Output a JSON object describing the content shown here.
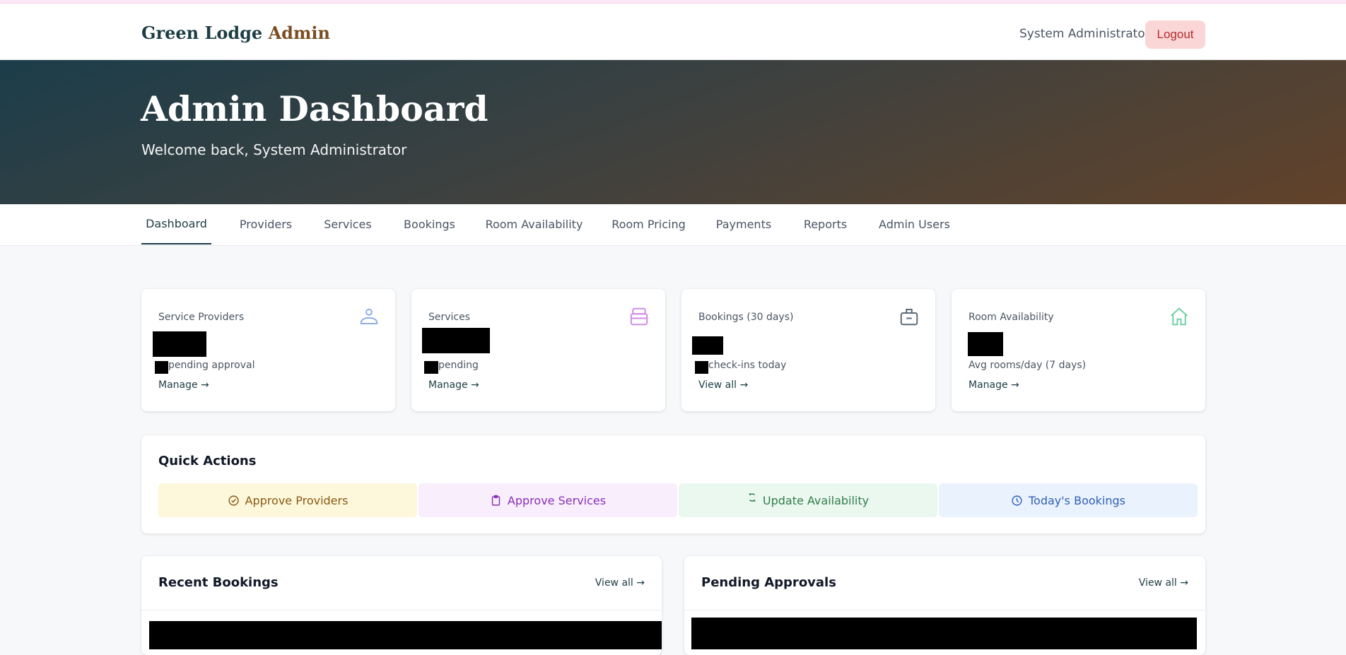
{
  "header": {
    "brand_main": "Green Lodge",
    "brand_accent": "Admin",
    "user_name": "System Administrator",
    "logout_label": "Logout"
  },
  "hero": {
    "title": "Admin Dashboard",
    "subtitle": "Welcome back, System Administrator"
  },
  "tabs": [
    {
      "label": "Dashboard",
      "active": true
    },
    {
      "label": "Providers"
    },
    {
      "label": "Services"
    },
    {
      "label": "Bookings"
    },
    {
      "label": "Room Availability"
    },
    {
      "label": "Room Pricing"
    },
    {
      "label": "Payments"
    },
    {
      "label": "Reports"
    },
    {
      "label": "Admin Users"
    }
  ],
  "stats": [
    {
      "label": "Service Providers",
      "sub": "pending approval",
      "link": "Manage →",
      "icon": "provider-icon",
      "color": "#8fb0e6"
    },
    {
      "label": "Services",
      "sub": "pending",
      "link": "Manage →",
      "icon": "stack-icon",
      "color": "#d08be6"
    },
    {
      "label": "Bookings (30 days)",
      "sub": "check-ins today",
      "link": "View all →",
      "icon": "briefcase-icon",
      "color": "#5b6b78"
    },
    {
      "label": "Room Availability",
      "sub": "Avg rooms/day (7 days)",
      "link": "Manage →",
      "icon": "home-icon",
      "color": "#6fd0a3"
    }
  ],
  "quick_actions": {
    "title": "Quick Actions",
    "items": [
      {
        "label": "Approve Providers",
        "icon": "check-circle-icon",
        "bg": "#fdf7dc",
        "fg": "#8a5a14"
      },
      {
        "label": "Approve Services",
        "icon": "clipboard-icon",
        "bg": "#f8eefc",
        "fg": "#8b2fb8"
      },
      {
        "label": "Update Availability",
        "icon": "refresh-icon",
        "bg": "#ebf8ef",
        "fg": "#2e7d4a"
      },
      {
        "label": "Today's Bookings",
        "icon": "clock-icon",
        "bg": "#eaf2fd",
        "fg": "#2f5fb8"
      }
    ]
  },
  "panels": {
    "recent_bookings": {
      "title": "Recent Bookings",
      "link": "View all →"
    },
    "pending_approvals": {
      "title": "Pending Approvals",
      "link": "View all →"
    }
  }
}
